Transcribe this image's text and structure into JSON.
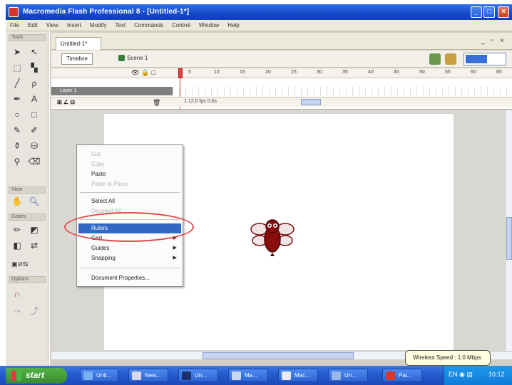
{
  "titlebar": {
    "title": "Macromedia Flash Professional 8 - [Untitled-1*]"
  },
  "menubar": {
    "items": [
      "File",
      "Edit",
      "View",
      "Insert",
      "Modify",
      "Text",
      "Commands",
      "Control",
      "Window",
      "Help"
    ]
  },
  "tools": {
    "tools_label": "Tools",
    "view_label": "View",
    "colors_label": "Colors",
    "options_label": "Options"
  },
  "document": {
    "tab_label": "Untitled-1*",
    "timeline_button": "Timeline",
    "scene_label": "Scene 1",
    "frame_numbers": [
      "5",
      "10",
      "15",
      "20",
      "25",
      "30",
      "35",
      "40",
      "45",
      "50",
      "55",
      "60",
      "65"
    ],
    "layer_name": "Layer 1",
    "status_readout": "1   12.0 fps   0.0s"
  },
  "context_menu": {
    "items": [
      {
        "label": "Cut",
        "disabled": true
      },
      {
        "label": "Copy",
        "disabled": true
      },
      {
        "label": "Paste",
        "disabled": false
      },
      {
        "label": "Paste in Place",
        "disabled": true
      },
      {
        "label": "Select All",
        "disabled": false
      },
      {
        "label": "Deselect All",
        "disabled": true
      },
      {
        "label": "Rulers",
        "disabled": false,
        "highlighted": true
      },
      {
        "label": "Grid",
        "disabled": false,
        "submenu": true
      },
      {
        "label": "Guides",
        "disabled": false,
        "submenu": true
      },
      {
        "label": "Snapping",
        "disabled": false,
        "submenu": true
      },
      {
        "label": "Document Properties...",
        "disabled": false
      }
    ]
  },
  "taskbar": {
    "start_label": "start",
    "tasks": [
      "Unti...",
      "New...",
      "Un...",
      "Ma...",
      "Mac...",
      "Un...",
      "Pai..."
    ],
    "tray_time": "10:12"
  },
  "balloon": {
    "text": "Wireless Speed : 1.0 Mbps"
  },
  "colors": {
    "accent": "#3168c6",
    "annotation": "#e04a4a"
  }
}
